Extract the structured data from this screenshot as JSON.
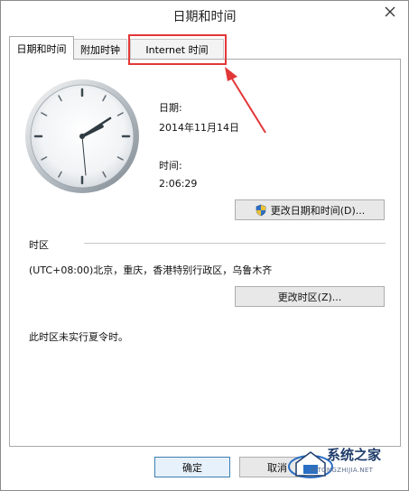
{
  "window": {
    "title": "日期和时间"
  },
  "tabs": [
    {
      "label": "日期和时间",
      "active": true
    },
    {
      "label": "附加时钟",
      "active": false
    },
    {
      "label": "Internet 时间",
      "active": false
    }
  ],
  "datetime": {
    "date_label": "日期:",
    "date_value": "2014年11月14日",
    "time_label": "时间:",
    "time_value": "2:06:29",
    "change_button": "更改日期和时间(D)..."
  },
  "timezone": {
    "section_label": "时区",
    "value": "(UTC+08:00)北京，重庆，香港特别行政区，乌鲁木齐",
    "change_button": "更改时区(Z)...",
    "dst_note": "此时区未实行夏令时。"
  },
  "footer": {
    "ok_label": "确定",
    "cancel_label": "取消"
  },
  "watermark": {
    "text": "系统之家",
    "url": "XITONGZHIJIA.NET"
  },
  "colors": {
    "highlight": "#e23737",
    "accent": "#3c7fb1"
  },
  "icons": {
    "close": "close-icon",
    "shield": "uac-shield-icon",
    "clock": "analog-clock-icon"
  }
}
